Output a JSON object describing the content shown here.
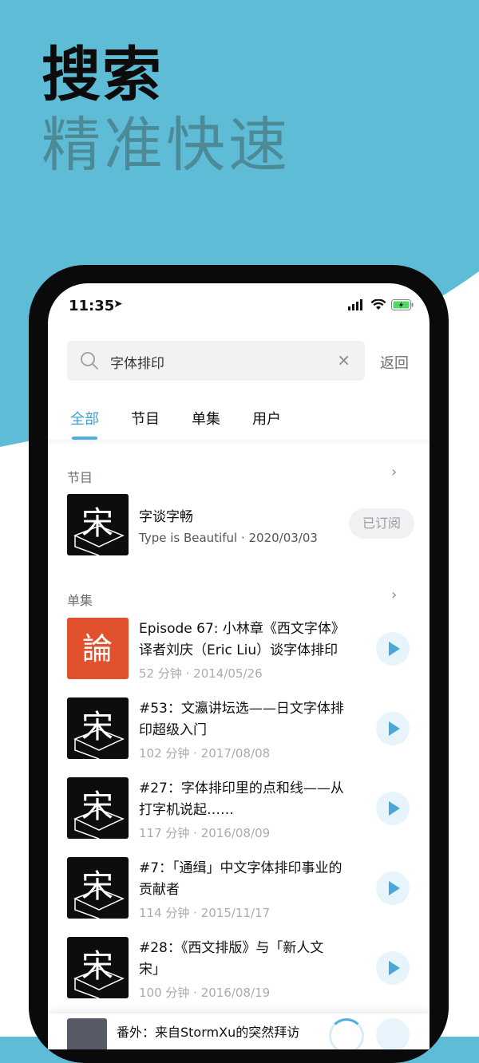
{
  "marketing": {
    "headline": "搜索",
    "subhead": "精准快速"
  },
  "status_bar": {
    "time": "11:35",
    "location_arrow": "➤"
  },
  "search": {
    "query": "字体排印",
    "clear": "×",
    "back": "返回"
  },
  "tabs": [
    {
      "label": "全部"
    },
    {
      "label": "节目"
    },
    {
      "label": "单集"
    },
    {
      "label": "用户"
    }
  ],
  "sections": {
    "programs_title": "节目",
    "episodes_title": "单集",
    "chevron": "›"
  },
  "program": {
    "cover_char": "宋",
    "title": "字谈字畅",
    "meta": "Type is Beautiful · 2020/03/03",
    "subscribed_label": "已订阅"
  },
  "episodes": [
    {
      "cover_char": "論",
      "title_line1": "Episode 67: 小林章《西文字体》",
      "title_line2": "译者刘庆（Eric Liu）谈字体排印",
      "meta": "52 分钟 · 2014/05/26"
    },
    {
      "cover_char": "宋",
      "title_line1": "#53：文瀛讲坛选——日文字体排",
      "title_line2": "印超级入门",
      "meta": "102 分钟 · 2017/08/08"
    },
    {
      "cover_char": "宋",
      "title_line1": "#27：字体排印里的点和线——从",
      "title_line2": "打字机说起……",
      "meta": "117 分钟 · 2016/08/09"
    },
    {
      "cover_char": "宋",
      "title_line1": "#7：「通缉」中文字体排印事业的",
      "title_line2": "贡献者",
      "meta": "114 分钟 · 2015/11/17"
    },
    {
      "cover_char": "宋",
      "title_line1": "#28：《西文排版》与「新人文",
      "title_line2": "宋」",
      "meta": "100 分钟 · 2016/08/19"
    }
  ],
  "mini_player": {
    "title": "番外：来自StormXu的突然拜访"
  },
  "colors": {
    "accent": "#4fb0db",
    "episode_cover_red": "#e2512e",
    "background": "#5fbcd6"
  }
}
